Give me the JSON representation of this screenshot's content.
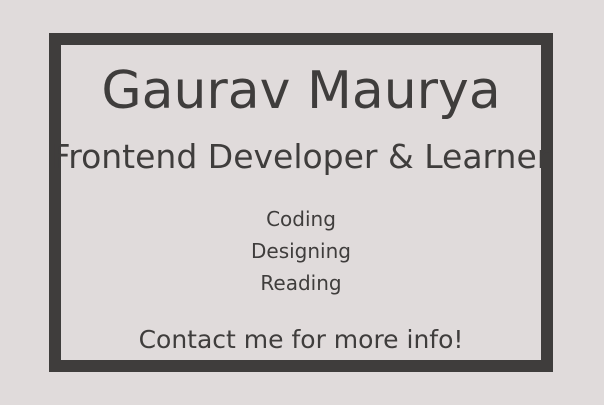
{
  "profile": {
    "name": "Gaurav Maurya",
    "title": "Frontend Developer & Learner"
  },
  "hobbies": [
    "Coding",
    "Designing",
    "Reading"
  ],
  "contact": {
    "text": "Contact me for more info!"
  },
  "colors": {
    "background": "#e0dbdb",
    "text": "#3f3d3c",
    "border": "#3f3d3c"
  }
}
